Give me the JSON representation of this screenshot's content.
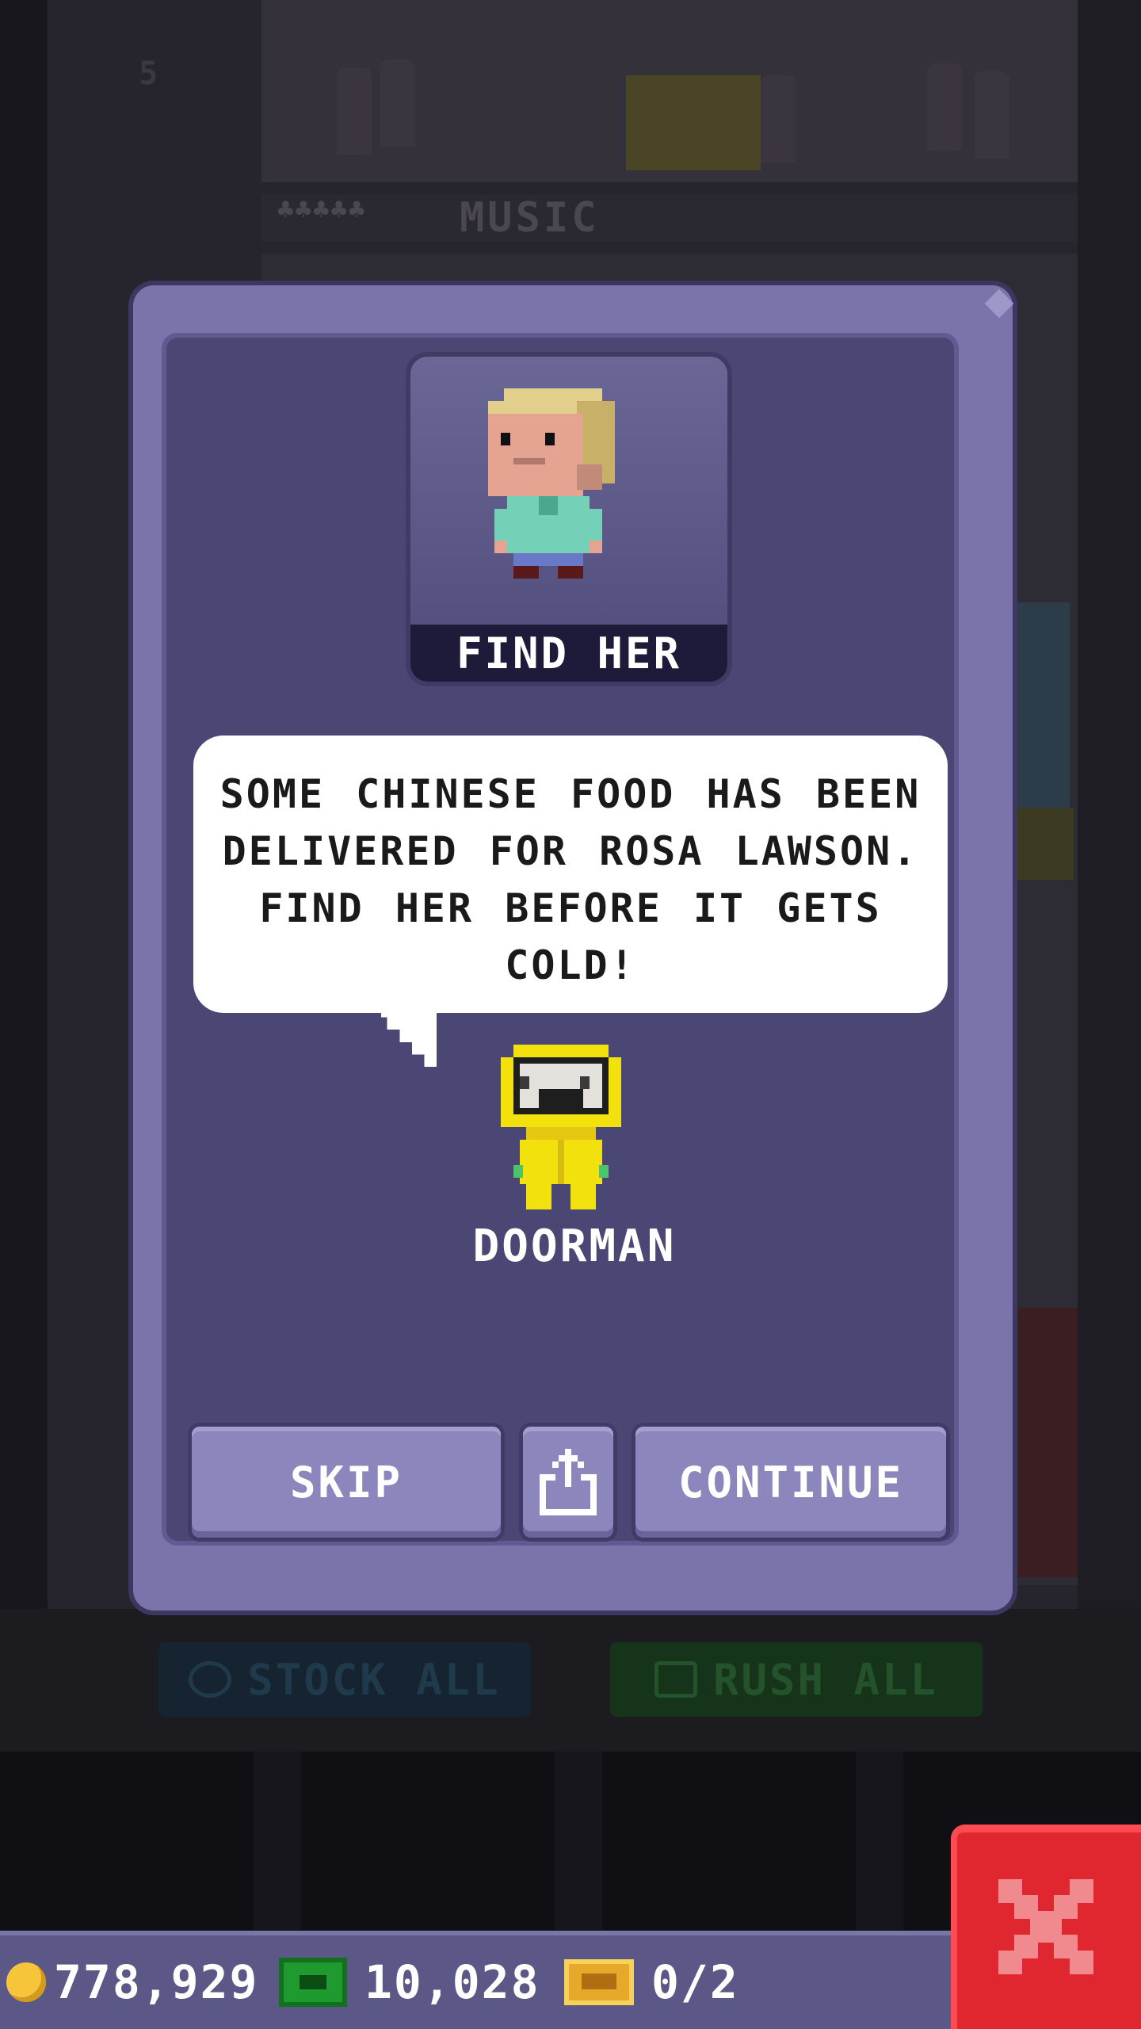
{
  "background": {
    "floor_label": "MUSIC",
    "floor_residents": "♣♣♣♣♣",
    "floor_number": "5",
    "actions": {
      "stock_all_label": "STOCK ALL",
      "rush_all_label": "RUSH ALL"
    }
  },
  "dialog": {
    "mission_label": "FIND HER",
    "message": "SOME CHINESE FOOD HAS BEEN DELIVERED FOR ROSA LAWSON. FIND HER BEFORE IT GETS COLD!",
    "speaker_name": "DOORMAN",
    "buttons": {
      "skip": "SKIP",
      "share_icon": "share-icon",
      "continue": "CONTINUE"
    }
  },
  "bank": {
    "coins": "778,929",
    "bux": "10,028",
    "tickets": "0/2"
  },
  "colors": {
    "panel": "#7b74ab",
    "panel_inner": "#4a4775",
    "button": "#8b86bc",
    "close": "#e0262f",
    "bux": "#1f9a2e",
    "coin": "#f6c53a",
    "doorman_yellow": "#f3e10e"
  }
}
